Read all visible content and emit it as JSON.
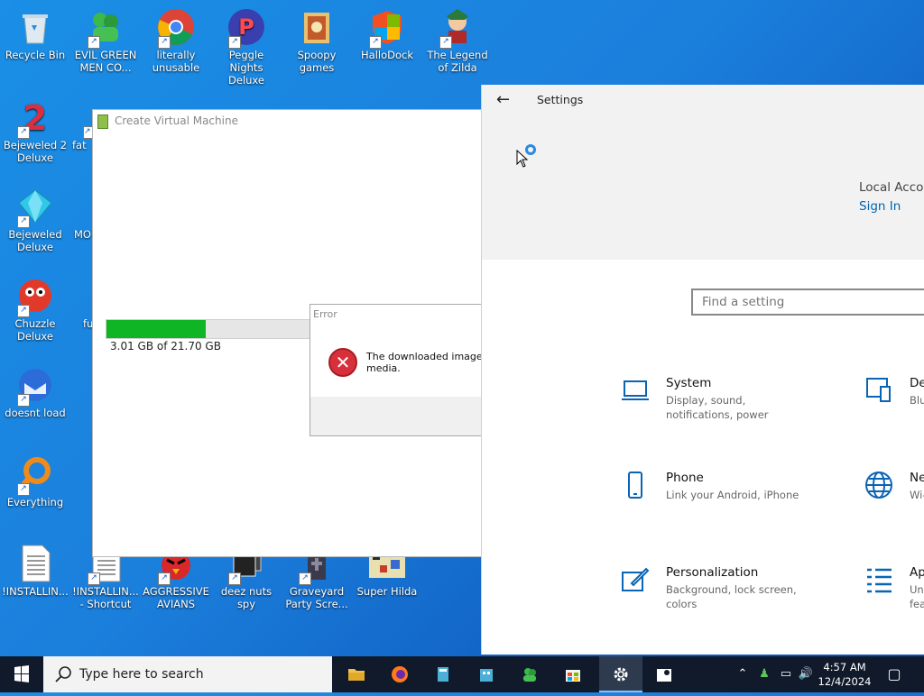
{
  "desktop_icons": [
    {
      "label": "Recycle Bin"
    },
    {
      "label": "EVIL GREEN MEN CO..."
    },
    {
      "label": "literally unusable"
    },
    {
      "label": "Peggle Nights Deluxe"
    },
    {
      "label": "Spoopy games"
    },
    {
      "label": "HalloDock"
    },
    {
      "label": "The Legend of Zilda"
    },
    {
      "label": "Bejeweled 2 Deluxe"
    },
    {
      "label": "fat"
    },
    {
      "label": "Bejeweled Deluxe"
    },
    {
      "label": "MO"
    },
    {
      "label": "Chuzzle Deluxe"
    },
    {
      "label": "fu"
    },
    {
      "label": "doesnt load"
    },
    {
      "label": "Everything"
    },
    {
      "label": "!INSTALLIN..."
    },
    {
      "label": "!INSTALLIN... - Shortcut"
    },
    {
      "label": "AGGRESSIVE AVIANS"
    },
    {
      "label": "deez nuts spy"
    },
    {
      "label": "Graveyard Party Scre..."
    },
    {
      "label": "Super Hilda"
    }
  ],
  "vm_window": {
    "title": "Create Virtual Machine",
    "progress_text": "3.01 GB of 21.70 GB",
    "progress_fraction": 0.139
  },
  "error_dialog": {
    "title": "Error",
    "message_line1": "The downloaded image c",
    "message_line2": "media."
  },
  "settings": {
    "title": "Settings",
    "account_label": "Local Accou",
    "sign_in": "Sign In",
    "search_placeholder": "Find a setting",
    "items": [
      {
        "name": "System",
        "desc": "Display, sound, notifications, power",
        "icon": "laptop-icon"
      },
      {
        "name": "De",
        "desc": "Blu",
        "icon": "devices-icon"
      },
      {
        "name": "Phone",
        "desc": "Link your Android, iPhone",
        "icon": "phone-icon"
      },
      {
        "name": "Ne",
        "desc": "Wi-",
        "icon": "globe-icon"
      },
      {
        "name": "Personalization",
        "desc": "Background, lock screen, colors",
        "icon": "brush-icon"
      },
      {
        "name": "Ap",
        "desc": "Un fea",
        "icon": "apps-icon"
      }
    ]
  },
  "taskbar": {
    "search_placeholder": "Type here to search",
    "time": "4:57 AM",
    "date": "12/4/2024"
  }
}
